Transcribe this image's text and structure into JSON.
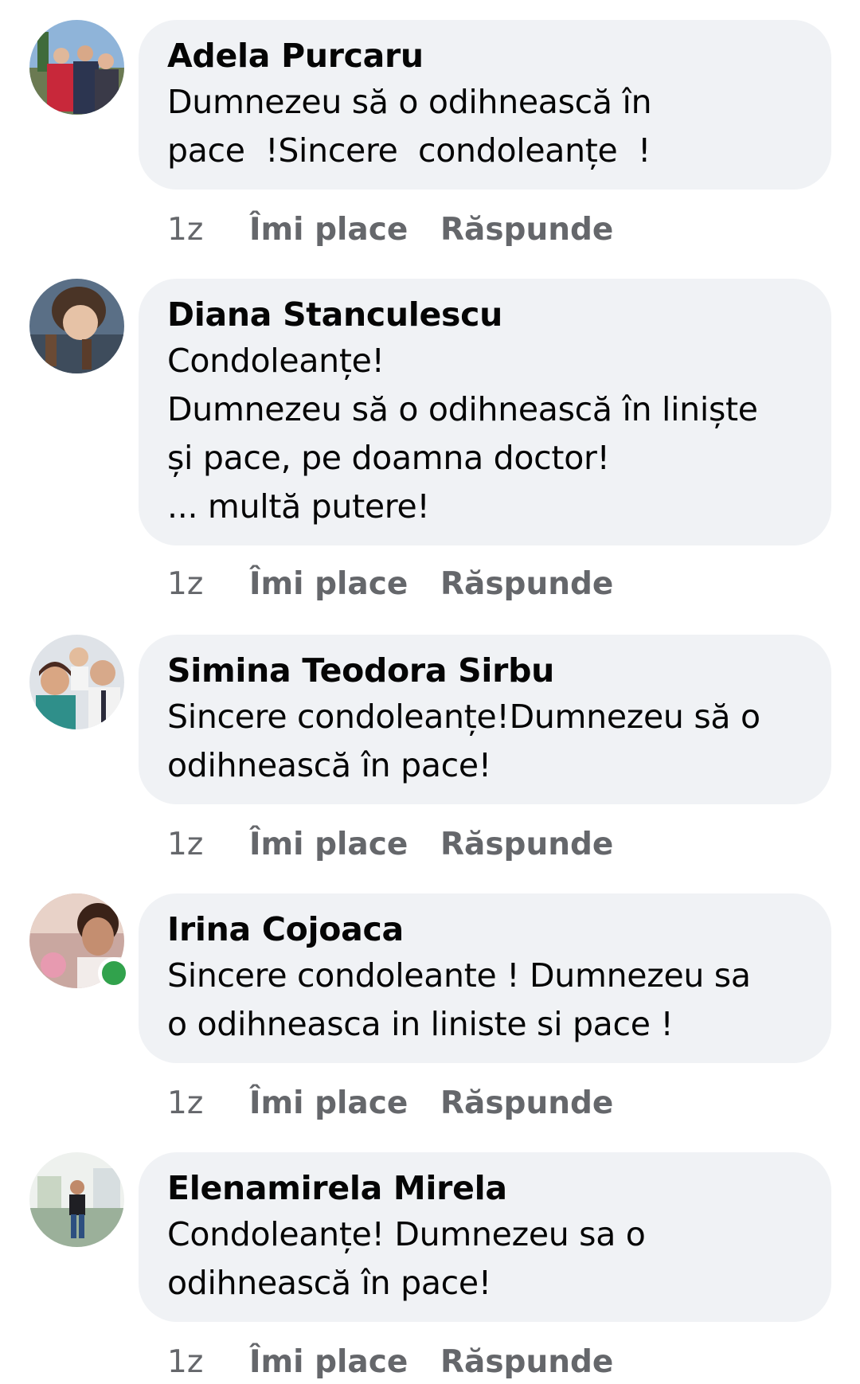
{
  "comments": [
    {
      "author": "Adela Purcaru",
      "text": "Dumnezeu să o odihnească în\npace  !Sincere  condoleanțe  !",
      "time": "1z",
      "like_label": "Îmi place",
      "reply_label": "Răspunde",
      "online": false
    },
    {
      "author": "Diana Stanculescu",
      "text": "Condoleanțe!\nDumnezeu să o odihnească în liniște\nși pace, pe doamna doctor!\n... multă putere!",
      "time": "1z",
      "like_label": "Îmi place",
      "reply_label": "Răspunde",
      "online": false
    },
    {
      "author": "Simina Teodora Sirbu",
      "text": "Sincere condoleanțe!Dumnezeu să o\nodihnească în pace!",
      "time": "1z",
      "like_label": "Îmi place",
      "reply_label": "Răspunde",
      "online": false
    },
    {
      "author": "Irina Cojoaca",
      "text": "Sincere condoleante ! Dumnezeu sa\no odihneasca in liniste si pace !",
      "time": "1z",
      "like_label": "Îmi place",
      "reply_label": "Răspunde",
      "online": true
    },
    {
      "author": "Elenamirela Mirela",
      "text": "Condoleanțe! Dumnezeu sa o\nodihnească în pace!",
      "time": "1z",
      "like_label": "Îmi place",
      "reply_label": "Răspunde",
      "online": false
    }
  ],
  "colors": {
    "bubble": "#f0f2f5",
    "meta_text": "#65676b",
    "online": "#31a24c"
  }
}
